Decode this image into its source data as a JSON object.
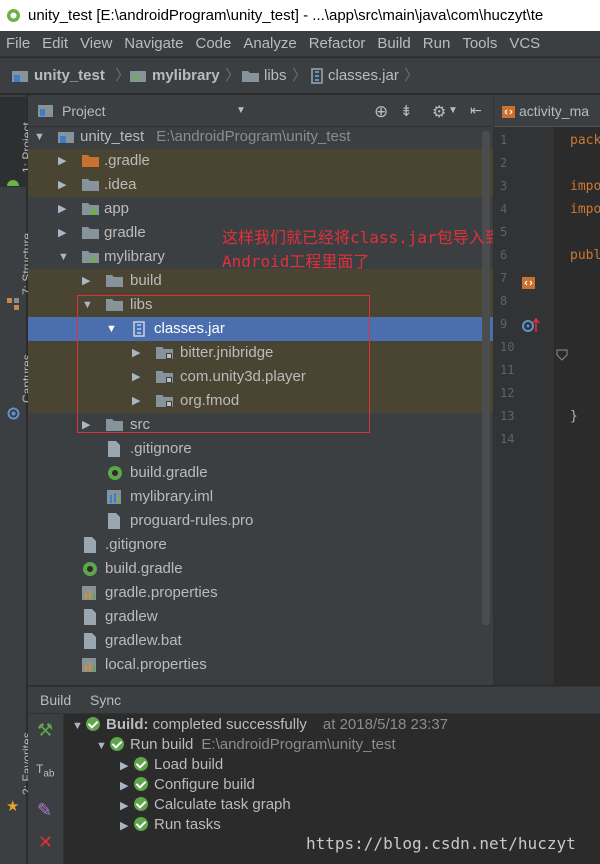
{
  "window": {
    "title": "unity_test [E:\\androidProgram\\unity_test] - ...\\app\\src\\main\\java\\com\\huczyt\\te"
  },
  "menu": [
    "File",
    "Edit",
    "View",
    "Navigate",
    "Code",
    "Analyze",
    "Refactor",
    "Build",
    "Run",
    "Tools",
    "VCS"
  ],
  "breadcrumb": {
    "items": [
      "unity_test",
      "mylibrary",
      "libs",
      "classes.jar"
    ]
  },
  "tool_stripe": {
    "project": "1: Project",
    "structure": "7: Structure",
    "captures": "Captures",
    "favorites": "2: Favorites"
  },
  "project_panel": {
    "title": "Project",
    "tree": [
      {
        "label": "unity_test",
        "path": "E:\\androidProgram\\unity_test",
        "icon": "module-icon"
      },
      {
        "label": ".gradle",
        "icon": "folder-orange-icon"
      },
      {
        "label": ".idea",
        "icon": "folder-icon"
      },
      {
        "label": "app",
        "icon": "module-folder-icon"
      },
      {
        "label": "gradle",
        "icon": "folder-icon"
      },
      {
        "label": "mylibrary",
        "icon": "library-module-icon"
      },
      {
        "label": "build",
        "icon": "folder-icon"
      },
      {
        "label": "libs",
        "icon": "folder-icon"
      },
      {
        "label": "classes.jar",
        "icon": "jar-icon"
      },
      {
        "label": "bitter.jnibridge",
        "icon": "package-icon"
      },
      {
        "label": "com.unity3d.player",
        "icon": "package-icon"
      },
      {
        "label": "org.fmod",
        "icon": "package-icon"
      },
      {
        "label": "src",
        "icon": "folder-icon"
      },
      {
        "label": ".gitignore",
        "icon": "file-icon"
      },
      {
        "label": "build.gradle",
        "icon": "gradle-icon"
      },
      {
        "label": "mylibrary.iml",
        "icon": "iml-icon"
      },
      {
        "label": "proguard-rules.pro",
        "icon": "file-icon"
      },
      {
        "label": ".gitignore",
        "icon": "file-icon"
      },
      {
        "label": "build.gradle",
        "icon": "gradle-icon"
      },
      {
        "label": "gradle.properties",
        "icon": "properties-icon"
      },
      {
        "label": "gradlew",
        "icon": "file-icon"
      },
      {
        "label": "gradlew.bat",
        "icon": "file-icon"
      },
      {
        "label": "local.properties",
        "icon": "properties-icon"
      }
    ]
  },
  "annotation": {
    "line1": "这样我们就已经将class.jar包导入到",
    "line2": "Android工程里面了"
  },
  "editor": {
    "tab": "activity_ma",
    "line_numbers": [
      "1",
      "2",
      "3",
      "4",
      "5",
      "6",
      "7",
      "8",
      "9",
      "10",
      "11",
      "12",
      "13",
      "14"
    ],
    "code": {
      "l1": "pack",
      "l3": "impo",
      "l4": "impo",
      "l6": "publ",
      "l13": "}"
    }
  },
  "build_panel": {
    "tabs": [
      "Build",
      "Sync"
    ],
    "status_label": "Build:",
    "status_text": "completed successfully",
    "timestamp": "at 2018/5/18 23:37",
    "run_build": "Run build",
    "run_build_path": "E:\\androidProgram\\unity_test",
    "steps": [
      "Load build",
      "Configure build",
      "Calculate task graph",
      "Run tasks"
    ]
  },
  "watermark": "https://blog.csdn.net/huczyt",
  "colors": {
    "accent_selection": "#4b6eaf",
    "highlight_box": "#e0313b",
    "success": "#5ea54c"
  }
}
